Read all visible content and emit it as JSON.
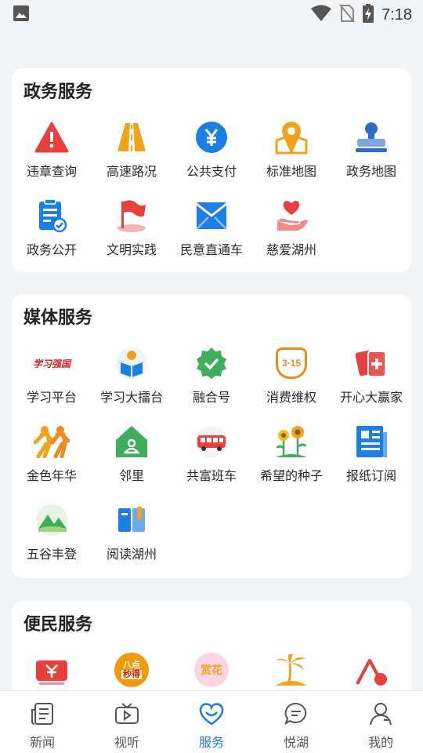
{
  "status_bar": {
    "time": "7:18"
  },
  "sections": [
    {
      "title": "政务服务",
      "items": [
        {
          "label": "违章查询",
          "icon": "warning-icon"
        },
        {
          "label": "高速路况",
          "icon": "highway-icon"
        },
        {
          "label": "公共支付",
          "icon": "yuan-icon"
        },
        {
          "label": "标准地图",
          "icon": "map-pin-icon"
        },
        {
          "label": "政务地图",
          "icon": "stamp-icon"
        },
        {
          "label": "政务公开",
          "icon": "clipboard-check-icon"
        },
        {
          "label": "文明实践",
          "icon": "flag-icon"
        },
        {
          "label": "民意直通车",
          "icon": "mail-icon"
        },
        {
          "label": "慈爱湖州",
          "icon": "heart-hand-icon"
        }
      ]
    },
    {
      "title": "媒体服务",
      "items": [
        {
          "label": "学习平台",
          "icon": "xuexi-logo-icon"
        },
        {
          "label": "学习大擂台",
          "icon": "reading-icon"
        },
        {
          "label": "融合号",
          "icon": "check-badge-icon"
        },
        {
          "label": "消费维权",
          "icon": "shield-315-icon"
        },
        {
          "label": "开心大赢家",
          "icon": "cards-icon"
        },
        {
          "label": "金色年华",
          "icon": "runners-icon"
        },
        {
          "label": "邻里",
          "icon": "house-icon"
        },
        {
          "label": "共富班车",
          "icon": "bus-icon"
        },
        {
          "label": "希望的种子",
          "icon": "sunflower-icon"
        },
        {
          "label": "报纸订阅",
          "icon": "newspaper-icon"
        },
        {
          "label": "五谷丰登",
          "icon": "mountain-icon"
        },
        {
          "label": "阅读湖州",
          "icon": "book-icon"
        }
      ]
    },
    {
      "title": "便民服务",
      "items": [
        {
          "label": "",
          "icon": "ticket-icon"
        },
        {
          "label": "",
          "icon": "clock-badge-icon"
        },
        {
          "label": "",
          "icon": "flower-icon"
        },
        {
          "label": "",
          "icon": "palm-icon"
        },
        {
          "label": "",
          "icon": "red-pin-icon"
        }
      ]
    }
  ],
  "icon_texts": {
    "xuexi": "学习强国",
    "badge_315": "3·15",
    "clock_badge_line1": "八点",
    "clock_badge_line2": "秒得",
    "flower_badge": "赏花"
  },
  "nav": [
    {
      "label": "新闻",
      "icon": "news-icon",
      "active": false
    },
    {
      "label": "视听",
      "icon": "tv-icon",
      "active": false
    },
    {
      "label": "服务",
      "icon": "service-heart-icon",
      "active": true
    },
    {
      "label": "悦湖",
      "icon": "chat-icon",
      "active": false
    },
    {
      "label": "我的",
      "icon": "profile-icon",
      "active": false
    }
  ],
  "colors": {
    "accent": "#1f7ae0",
    "red": "#e8403c",
    "orange": "#f2a31c",
    "blue": "#1c7fe6",
    "green": "#3fae5c"
  }
}
